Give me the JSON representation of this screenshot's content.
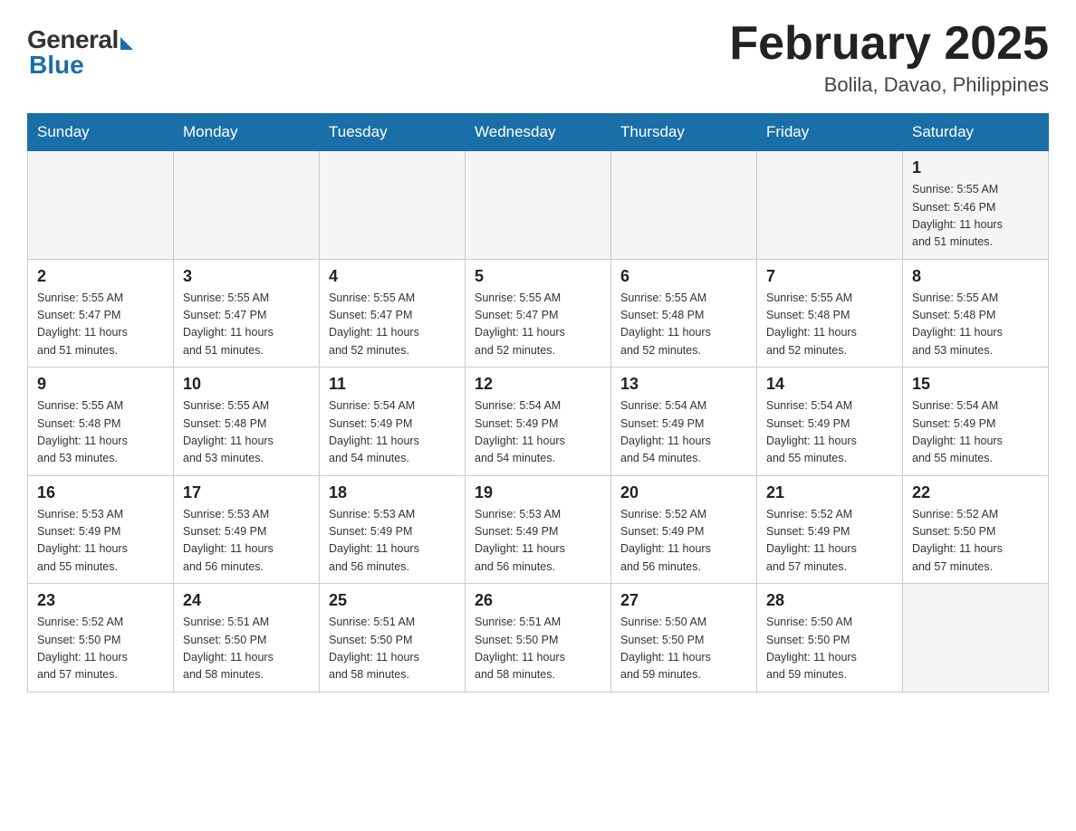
{
  "logo": {
    "general": "General",
    "blue": "Blue"
  },
  "header": {
    "title": "February 2025",
    "location": "Bolila, Davao, Philippines"
  },
  "weekdays": [
    "Sunday",
    "Monday",
    "Tuesday",
    "Wednesday",
    "Thursday",
    "Friday",
    "Saturday"
  ],
  "weeks": [
    [
      {
        "day": "",
        "info": ""
      },
      {
        "day": "",
        "info": ""
      },
      {
        "day": "",
        "info": ""
      },
      {
        "day": "",
        "info": ""
      },
      {
        "day": "",
        "info": ""
      },
      {
        "day": "",
        "info": ""
      },
      {
        "day": "1",
        "info": "Sunrise: 5:55 AM\nSunset: 5:46 PM\nDaylight: 11 hours\nand 51 minutes."
      }
    ],
    [
      {
        "day": "2",
        "info": "Sunrise: 5:55 AM\nSunset: 5:47 PM\nDaylight: 11 hours\nand 51 minutes."
      },
      {
        "day": "3",
        "info": "Sunrise: 5:55 AM\nSunset: 5:47 PM\nDaylight: 11 hours\nand 51 minutes."
      },
      {
        "day": "4",
        "info": "Sunrise: 5:55 AM\nSunset: 5:47 PM\nDaylight: 11 hours\nand 52 minutes."
      },
      {
        "day": "5",
        "info": "Sunrise: 5:55 AM\nSunset: 5:47 PM\nDaylight: 11 hours\nand 52 minutes."
      },
      {
        "day": "6",
        "info": "Sunrise: 5:55 AM\nSunset: 5:48 PM\nDaylight: 11 hours\nand 52 minutes."
      },
      {
        "day": "7",
        "info": "Sunrise: 5:55 AM\nSunset: 5:48 PM\nDaylight: 11 hours\nand 52 minutes."
      },
      {
        "day": "8",
        "info": "Sunrise: 5:55 AM\nSunset: 5:48 PM\nDaylight: 11 hours\nand 53 minutes."
      }
    ],
    [
      {
        "day": "9",
        "info": "Sunrise: 5:55 AM\nSunset: 5:48 PM\nDaylight: 11 hours\nand 53 minutes."
      },
      {
        "day": "10",
        "info": "Sunrise: 5:55 AM\nSunset: 5:48 PM\nDaylight: 11 hours\nand 53 minutes."
      },
      {
        "day": "11",
        "info": "Sunrise: 5:54 AM\nSunset: 5:49 PM\nDaylight: 11 hours\nand 54 minutes."
      },
      {
        "day": "12",
        "info": "Sunrise: 5:54 AM\nSunset: 5:49 PM\nDaylight: 11 hours\nand 54 minutes."
      },
      {
        "day": "13",
        "info": "Sunrise: 5:54 AM\nSunset: 5:49 PM\nDaylight: 11 hours\nand 54 minutes."
      },
      {
        "day": "14",
        "info": "Sunrise: 5:54 AM\nSunset: 5:49 PM\nDaylight: 11 hours\nand 55 minutes."
      },
      {
        "day": "15",
        "info": "Sunrise: 5:54 AM\nSunset: 5:49 PM\nDaylight: 11 hours\nand 55 minutes."
      }
    ],
    [
      {
        "day": "16",
        "info": "Sunrise: 5:53 AM\nSunset: 5:49 PM\nDaylight: 11 hours\nand 55 minutes."
      },
      {
        "day": "17",
        "info": "Sunrise: 5:53 AM\nSunset: 5:49 PM\nDaylight: 11 hours\nand 56 minutes."
      },
      {
        "day": "18",
        "info": "Sunrise: 5:53 AM\nSunset: 5:49 PM\nDaylight: 11 hours\nand 56 minutes."
      },
      {
        "day": "19",
        "info": "Sunrise: 5:53 AM\nSunset: 5:49 PM\nDaylight: 11 hours\nand 56 minutes."
      },
      {
        "day": "20",
        "info": "Sunrise: 5:52 AM\nSunset: 5:49 PM\nDaylight: 11 hours\nand 56 minutes."
      },
      {
        "day": "21",
        "info": "Sunrise: 5:52 AM\nSunset: 5:49 PM\nDaylight: 11 hours\nand 57 minutes."
      },
      {
        "day": "22",
        "info": "Sunrise: 5:52 AM\nSunset: 5:50 PM\nDaylight: 11 hours\nand 57 minutes."
      }
    ],
    [
      {
        "day": "23",
        "info": "Sunrise: 5:52 AM\nSunset: 5:50 PM\nDaylight: 11 hours\nand 57 minutes."
      },
      {
        "day": "24",
        "info": "Sunrise: 5:51 AM\nSunset: 5:50 PM\nDaylight: 11 hours\nand 58 minutes."
      },
      {
        "day": "25",
        "info": "Sunrise: 5:51 AM\nSunset: 5:50 PM\nDaylight: 11 hours\nand 58 minutes."
      },
      {
        "day": "26",
        "info": "Sunrise: 5:51 AM\nSunset: 5:50 PM\nDaylight: 11 hours\nand 58 minutes."
      },
      {
        "day": "27",
        "info": "Sunrise: 5:50 AM\nSunset: 5:50 PM\nDaylight: 11 hours\nand 59 minutes."
      },
      {
        "day": "28",
        "info": "Sunrise: 5:50 AM\nSunset: 5:50 PM\nDaylight: 11 hours\nand 59 minutes."
      },
      {
        "day": "",
        "info": ""
      }
    ]
  ]
}
